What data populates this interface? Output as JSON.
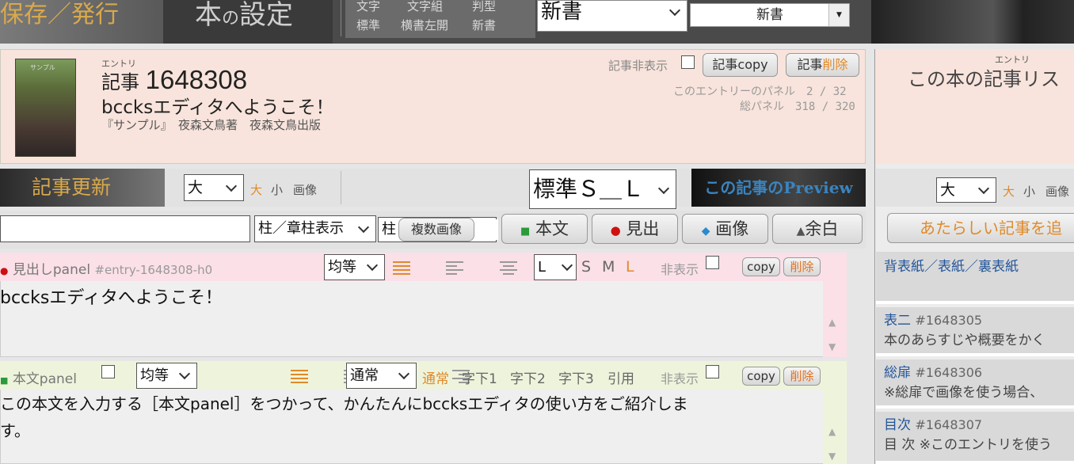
{
  "topbar": {
    "save_publish": "保存／発行",
    "book_settings_main": "本",
    "book_settings_no": "の",
    "book_settings_tail": "設定",
    "labels_top": [
      "文字",
      "文字組",
      "判型"
    ],
    "labels_bottom": [
      "標準",
      "横書左開",
      "新書"
    ],
    "format_select": "新書",
    "format_select2": "新書"
  },
  "entry": {
    "ruby": "エントリ",
    "kind": "記事",
    "id": "1648308",
    "title": "bccksエディタへようこそ！",
    "book_line": "『サンプル』　夜森文鳥著　夜森文鳥出版",
    "cover_text": "サンプル",
    "hide_label": "記事非表示",
    "copy_button": "記事copy",
    "delete_button_prefix": "記事",
    "delete_button_suffix": "削除",
    "panel_count": "このエントリーのパネル　2 / 32",
    "total_panels": "総パネル　318 / 320"
  },
  "toolbar": {
    "update_button": "記事更新",
    "size_select": "大",
    "size_large": "大",
    "size_small": "小",
    "size_image": "画像",
    "style_select": "標準Ｓ＿Ｌ",
    "preview_button": "この記事のPreview"
  },
  "toolbar2": {
    "text_input": "",
    "pillar_select": "柱／章柱表示",
    "pillar_select2": "柱",
    "multi_image": "複数画像",
    "add_text": "本文",
    "add_heading": "見出",
    "add_image": "画像",
    "add_margin": "余白"
  },
  "heading_panel": {
    "label": "見出しpanel",
    "anchor": "#entry-1648308-h0",
    "align_select": "均等",
    "size_select": "L",
    "size_s": "S",
    "size_m": "M",
    "size_l": "L",
    "hide_label": "非表示",
    "copy": "copy",
    "delete": "削除",
    "text": "bccksエディタへようこそ！"
  },
  "body_panel": {
    "label": "本文panel",
    "align_select": "均等",
    "indent_select": "通常",
    "indent_normal": "通常",
    "indent_1": "字下1",
    "indent_2": "字下2",
    "indent_3": "字下3",
    "quote": "引用",
    "hide_label": "非表示",
    "copy": "copy",
    "delete": "削除",
    "text_line1": "この本文を入力する［本文panel］をつかって、かんたんにbccksエディタの使い方をご紹介しま",
    "text_line2": "す。"
  },
  "sidebar": {
    "ruby": "エントリ",
    "title": "この本の記事リス",
    "size_select": "大",
    "size_large": "大",
    "size_small": "小",
    "size_image": "画像",
    "new_entry": "あたらしい記事を追",
    "items": [
      {
        "title": "背表紙／表紙／裏表紙",
        "id": "",
        "desc": ""
      },
      {
        "title": "表二",
        "id": "#1648305",
        "desc": "本のあらすじや概要をかく"
      },
      {
        "title": "総扉",
        "id": "#1648306",
        "desc": "※総扉で画像を使う場合、"
      },
      {
        "title": "目次",
        "id": "#1648307",
        "desc": "目 次 ※このエントリを使う"
      }
    ]
  }
}
